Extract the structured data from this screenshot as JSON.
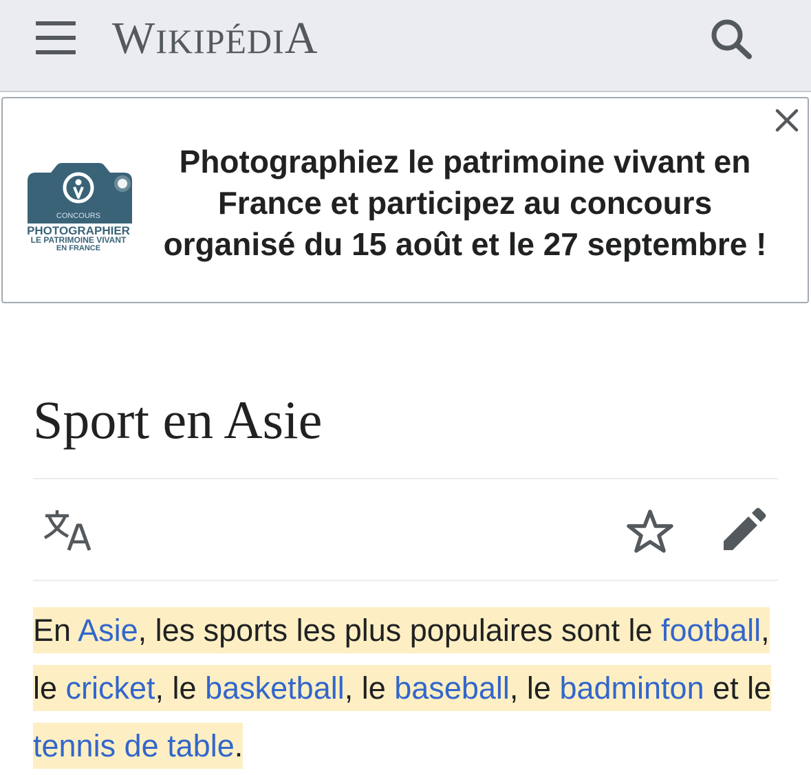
{
  "header": {
    "wordmark": {
      "w": "W",
      "iki": "IKIPÉDI",
      "a": "A"
    },
    "menu_icon": "hamburger-icon",
    "search_icon": "search-icon"
  },
  "banner": {
    "logo": {
      "line1": "CONCOURS",
      "line2": "PHOTOGRAPHIER",
      "line3": "LE PATRIMOINE VIVANT",
      "line4": "EN FRANCE"
    },
    "line1": "Photographiez le patrimoine vivant en",
    "line2": "France et participez au concours",
    "line3": "organisé du 15 août et le 27 septembre !",
    "close_icon": "close-icon"
  },
  "article": {
    "title": "Sport en Asie",
    "actions": {
      "translate_icon": "translate-icon",
      "watch_icon": "star-icon",
      "edit_icon": "pencil-icon"
    },
    "paragraph": {
      "t0": "En ",
      "l_asie": "Asie",
      "t1": ", les sports les plus populaires sont le ",
      "l_football": "football",
      "t2": ", le ",
      "l_cricket": "cricket",
      "t3": ", le ",
      "l_basketball": "basketball",
      "t4": ", le ",
      "l_baseball": "baseball",
      "t5": ", le ",
      "l_badminton": "badminton",
      "t6": " et le ",
      "l_tennis": "tennis de table",
      "t7": "."
    }
  },
  "colors": {
    "header_bg": "#eaecf0",
    "link": "#3366cc",
    "highlight": "#fdefc3",
    "logo_teal": "#3a6378",
    "text": "#202122",
    "icon": "#54595d"
  }
}
